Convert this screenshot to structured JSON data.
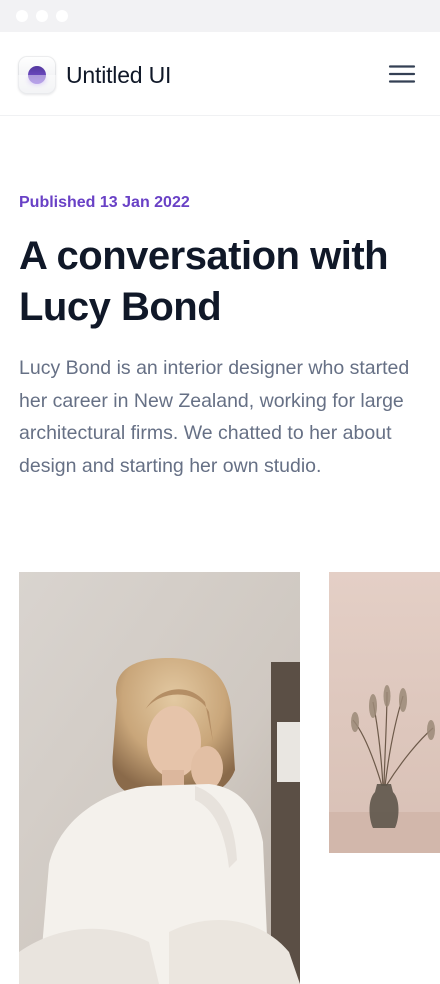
{
  "brand": {
    "name": "Untitled UI",
    "accent_color": "#6941c6"
  },
  "nav": {
    "menu_icon": "hamburger-menu-icon"
  },
  "article": {
    "published": "Published 13 Jan 2022",
    "title": "A conversation with Lucy Bond",
    "lede": "Lucy Bond is an interior designer who started her career in New Zealand, working for large architectural firms. We chatted to her about design and starting her own studio."
  },
  "gallery": {
    "images": [
      {
        "subject": "woman-in-white-shirt-portrait"
      },
      {
        "subject": "vase-with-dried-grass"
      }
    ]
  }
}
